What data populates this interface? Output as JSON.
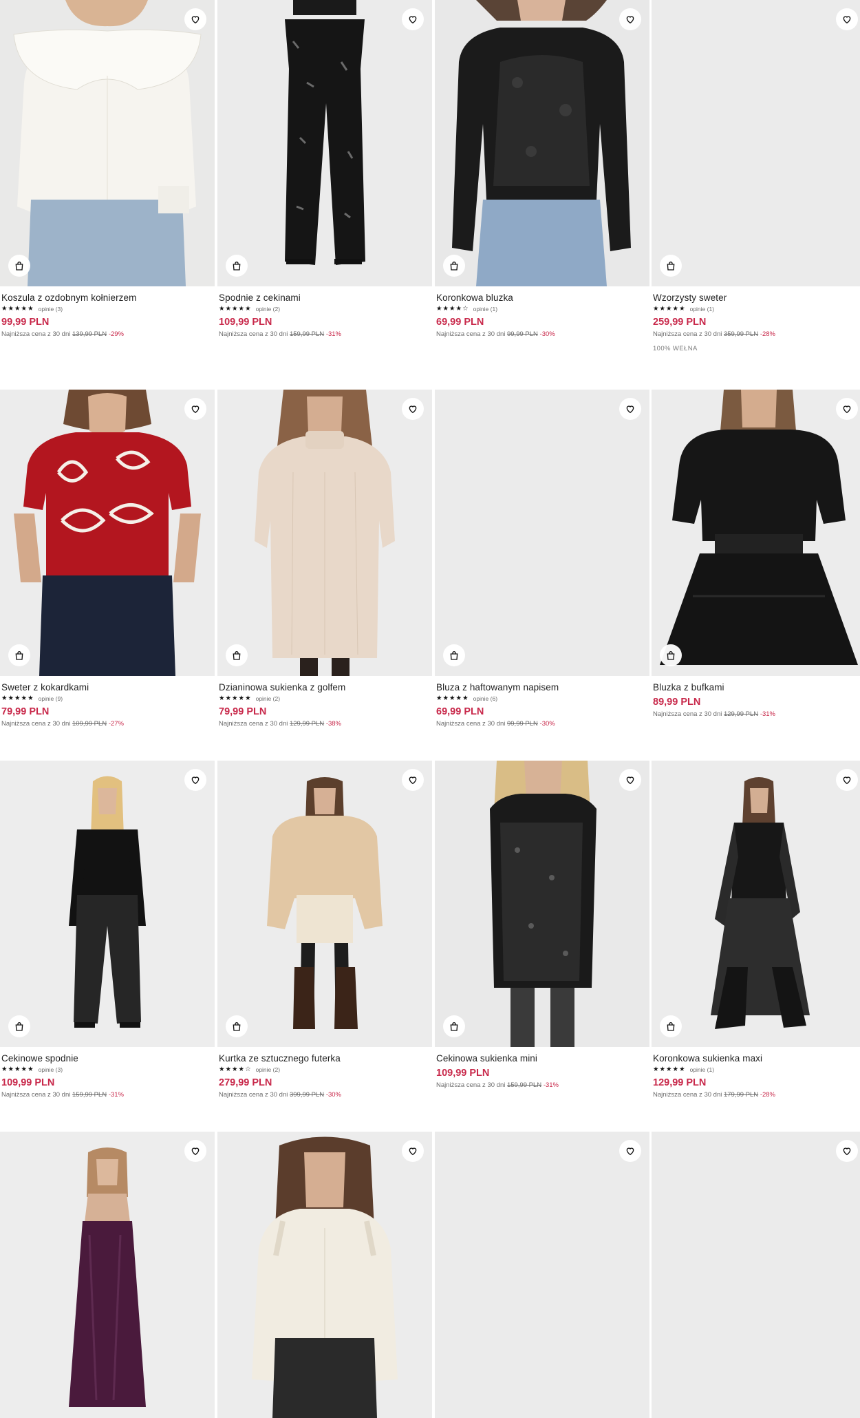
{
  "labels": {
    "lowest_price": "Najniższa cena z 30 dni",
    "reviews_word": "opinie"
  },
  "products": [
    {
      "name": "Koszula z ozdobnym kołnierzem",
      "stars": "★★★★★",
      "reviews": "opinie (3)",
      "price": "99,99 PLN",
      "old_price": "139,99 PLN",
      "discount": "-29%",
      "image": "white-blouse-with-big-collar"
    },
    {
      "name": "Spodnie z cekinami",
      "stars": "★★★★★",
      "reviews": "opinie (2)",
      "price": "109,99 PLN",
      "old_price": "159,99 PLN",
      "discount": "-31%",
      "image": "black-sequin-trousers"
    },
    {
      "name": "Koronkowa bluzka",
      "stars": "★★★★☆",
      "reviews": "opinie (1)",
      "price": "69,99 PLN",
      "old_price": "99,99 PLN",
      "discount": "-30%",
      "image": "black-lace-blouse"
    },
    {
      "name": "Wzorzysty sweter",
      "stars": "★★★★★",
      "reviews": "opinie (1)",
      "price": "259,99 PLN",
      "old_price": "359,99 PLN",
      "discount": "-28%",
      "badge": "100% WEŁNA",
      "image": "blank"
    },
    {
      "name": "Sweter z kokardkami",
      "stars": "★★★★★",
      "reviews": "opinie (9)",
      "price": "79,99 PLN",
      "old_price": "109,99 PLN",
      "discount": "-27%",
      "image": "red-sweater-with-bows"
    },
    {
      "name": "Dzianinowa sukienka z golfem",
      "stars": "★★★★★",
      "reviews": "opinie (2)",
      "price": "79,99 PLN",
      "old_price": "129,99 PLN",
      "discount": "-38%",
      "image": "beige-knit-dress"
    },
    {
      "name": "Bluza z haftowanym napisem",
      "stars": "★★★★★",
      "reviews": "opinie (6)",
      "price": "69,99 PLN",
      "old_price": "99,99 PLN",
      "discount": "-30%",
      "image": "blank"
    },
    {
      "name": "Bluzka z bufkami",
      "price": "89,99 PLN",
      "old_price": "129,99 PLN",
      "discount": "-31%",
      "image": "black-puff-sleeve-top"
    },
    {
      "name": "Cekinowe spodnie",
      "stars": "★★★★★",
      "reviews": "opinie (3)",
      "price": "109,99 PLN",
      "old_price": "159,99 PLN",
      "discount": "-31%",
      "image": "sequin-pants-outfit"
    },
    {
      "name": "Kurtka ze sztucznego futerka",
      "stars": "★★★★☆",
      "reviews": "opinie (2)",
      "price": "279,99 PLN",
      "old_price": "399,99 PLN",
      "discount": "-30%",
      "image": "faux-fur-jacket"
    },
    {
      "name": "Cekinowa sukienka mini",
      "price": "109,99 PLN",
      "old_price": "159,99 PLN",
      "discount": "-31%",
      "image": "sequin-mini-dress"
    },
    {
      "name": "Koronkowa sukienka maxi",
      "stars": "★★★★★",
      "reviews": "opinie (1)",
      "price": "129,99 PLN",
      "old_price": "179,99 PLN",
      "discount": "-28%",
      "image": "lace-maxi-dress"
    },
    {
      "image": "purple-velvet-slip-dress"
    },
    {
      "image": "cream-knit-cardigan"
    },
    {
      "image": "blank"
    },
    {
      "image": "blank"
    }
  ],
  "colors": {
    "price": "#c8284a",
    "text": "#1f1f1f",
    "photo_bg": "#ececec"
  },
  "icons": {
    "favorite": "heart-icon",
    "add_to_cart": "shopping-bag-icon"
  }
}
